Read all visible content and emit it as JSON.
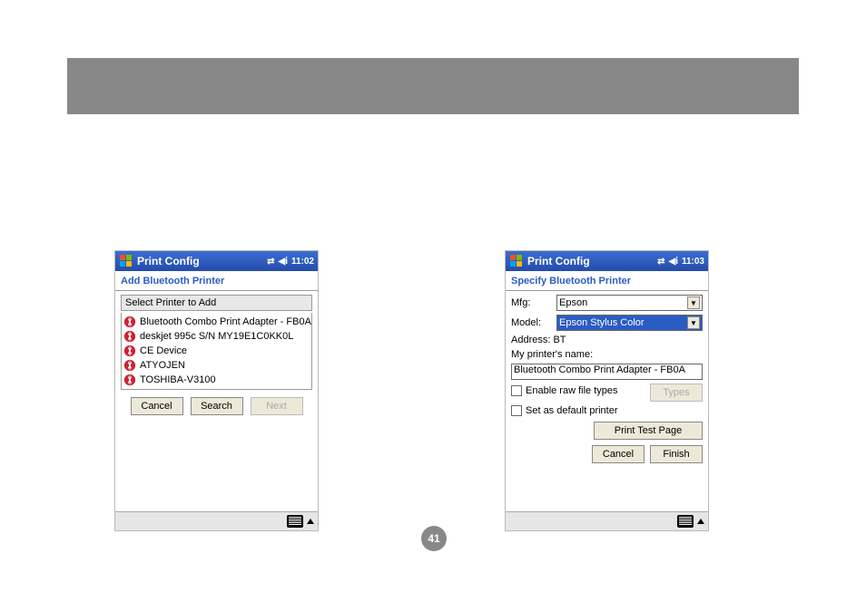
{
  "page_number": "41",
  "left": {
    "titlebar_app": "Print Config",
    "time": "11:02",
    "subhead": "Add Bluetooth Printer",
    "panel_label": "Select Printer to Add",
    "items": [
      "Bluetooth Combo Print Adapter - FB0A",
      "deskjet 995c S/N MY19E1C0KK0L",
      "CE Device",
      "ATYOJEN",
      "TOSHIBA-V3100"
    ],
    "btn_cancel": "Cancel",
    "btn_search": "Search",
    "btn_next": "Next"
  },
  "right": {
    "titlebar_app": "Print Config",
    "time": "11:03",
    "subhead": "Specify Bluetooth Printer",
    "label_mfg": "Mfg:",
    "mfg_value": "Epson",
    "label_model": "Model:",
    "model_value": "Epson Stylus Color",
    "label_address": "Address: BT",
    "label_printers_name": "My printer's name:",
    "printers_name_value": "Bluetooth Combo Print Adapter - FB0A",
    "chk_raw": "Enable raw file types",
    "btn_types": "Types",
    "chk_default": "Set as default printer",
    "btn_test": "Print Test Page",
    "btn_cancel": "Cancel",
    "btn_finish": "Finish"
  }
}
